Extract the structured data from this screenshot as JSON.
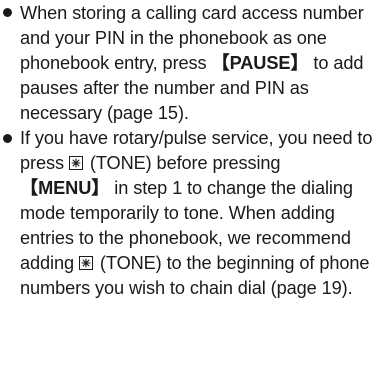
{
  "items": [
    {
      "seg1": "When storing a calling card access number and your PIN in the phonebook as one phonebook entry, press ",
      "key_pause": "PAUSE",
      "seg2": " to add pauses after the number and PIN as necessary (page 15)."
    },
    {
      "seg1": "If you have rotary/pulse service, you need to press ",
      "star_icon": "star-key-icon",
      "tone_1": " (TONE) before pressing ",
      "key_menu": "MENU",
      "seg2": " in step 1 to change the dialing mode temporarily to tone. When adding entries to the phonebook, we recommend adding ",
      "tone_2": " (TONE) to the beginning of phone numbers you wish to chain dial (page 19)."
    }
  ],
  "brackets": {
    "open": "【",
    "close": "】"
  }
}
